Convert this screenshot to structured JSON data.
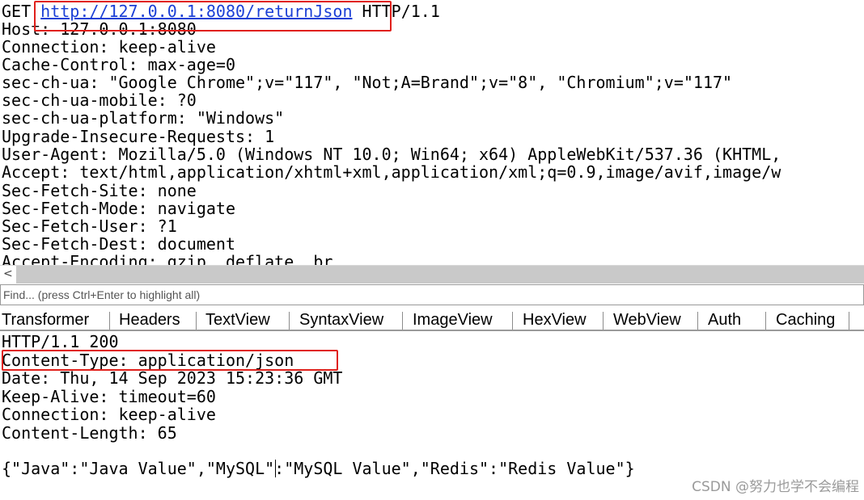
{
  "request": {
    "method": "GET",
    "url": "http://127.0.0.1:8080/returnJson",
    "protocol": "HTTP/1.1",
    "headers": [
      "Host: 127.0.0.1:8080",
      "Connection: keep-alive",
      "Cache-Control: max-age=0",
      "sec-ch-ua: \"Google Chrome\";v=\"117\", \"Not;A=Brand\";v=\"8\", \"Chromium\";v=\"117\"",
      "sec-ch-ua-mobile: ?0",
      "sec-ch-ua-platform: \"Windows\"",
      "Upgrade-Insecure-Requests: 1",
      "User-Agent: Mozilla/5.0 (Windows NT 10.0; Win64; x64) AppleWebKit/537.36 (KHTML,",
      "Accept: text/html,application/xhtml+xml,application/xml;q=0.9,image/avif,image/w",
      "Sec-Fetch-Site: none",
      "Sec-Fetch-Mode: navigate",
      "Sec-Fetch-User: ?1",
      "Sec-Fetch-Dest: document",
      "Accept-Encoding: gzip, deflate, br"
    ]
  },
  "find_bar": {
    "placeholder": "Find... (press Ctrl+Enter to highlight all)"
  },
  "tabs": [
    "Transformer",
    "Headers",
    "TextView",
    "SyntaxView",
    "ImageView",
    "HexView",
    "WebView",
    "Auth",
    "Caching"
  ],
  "response": {
    "lines": [
      "HTTP/1.1 200",
      "Content-Type: application/json",
      "Date: Thu, 14 Sep 2023 15:23:36 GMT",
      "Keep-Alive: timeout=60",
      "Connection: keep-alive",
      "Content-Length: 65"
    ],
    "body": "{\"Java\":\"Java Value\",\"MySQL\":\"MySQL Value\",\"Redis\":\"Redis Value\"}"
  },
  "watermark": "CSDN @努力也学不会编程",
  "colors": {
    "highlight_box": "#e0201b",
    "link": "#1a3fd6"
  }
}
